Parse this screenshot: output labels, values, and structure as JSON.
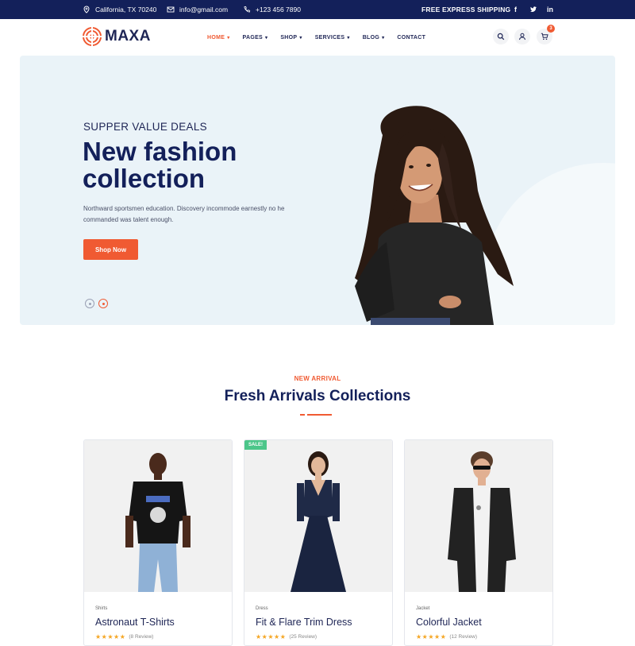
{
  "topbar": {
    "location": "California, TX 70240",
    "email": "info@gmail.com",
    "phone": "+123 456 7890",
    "shipping": "FREE EXPRESS SHIPPING",
    "social": {
      "facebook": "f",
      "twitter": "t",
      "linkedin": "in"
    },
    "icons": [
      "map-pin-icon",
      "mail-icon",
      "phone-icon"
    ]
  },
  "header": {
    "logo_text": "MAXA",
    "nav": [
      {
        "label": "HOME",
        "active": true,
        "dropdown": true
      },
      {
        "label": "PAGES",
        "dropdown": true
      },
      {
        "label": "SHOP",
        "dropdown": true
      },
      {
        "label": "SERVICES",
        "dropdown": true
      },
      {
        "label": "BLOG",
        "dropdown": true
      },
      {
        "label": "CONTACT",
        "dropdown": false
      }
    ],
    "cart_count": "3",
    "icons": [
      "search-icon",
      "user-icon",
      "cart-icon"
    ]
  },
  "hero": {
    "kicker": "SUPPER VALUE DEALS",
    "title": "New fashion collection",
    "description": "Northward sportsmen education. Discovery incommode earnestly no he commanded was talent enough.",
    "button": "Shop Now",
    "slides": 2,
    "active_slide": 2
  },
  "section": {
    "kicker": "NEW ARRIVAL",
    "title": "Fresh Arrivals Collections"
  },
  "products": [
    {
      "category": "Shirts",
      "name": "Astronaut T-Shirts",
      "reviews": "(8 Review)",
      "sale": ""
    },
    {
      "category": "Dress",
      "name": "Fit & Flare Trim Dress",
      "reviews": "(25 Review)",
      "sale": "SALE!"
    },
    {
      "category": "Jacket",
      "name": "Colorful Jacket",
      "reviews": "(12 Review)",
      "sale": ""
    }
  ],
  "colors": {
    "accent": "#f05a32",
    "navy": "#13205a",
    "hero_bg": "#eaf3f8",
    "sale": "#4cc68a",
    "star": "#f5a623"
  }
}
